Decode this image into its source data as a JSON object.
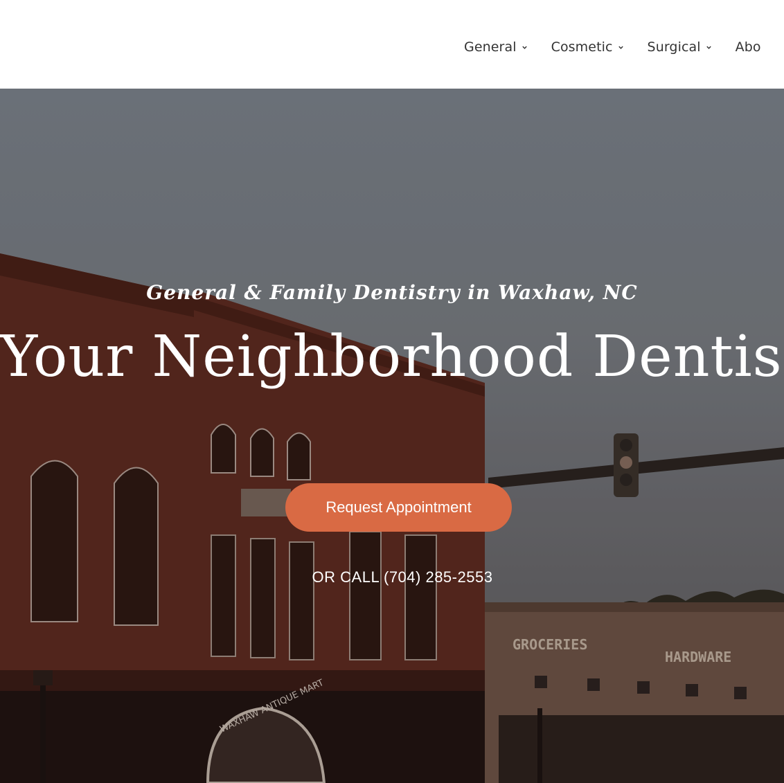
{
  "nav": {
    "items": [
      {
        "label": "General",
        "icon": "chevron-down-icon"
      },
      {
        "label": "Cosmetic",
        "icon": "chevron-down-icon"
      },
      {
        "label": "Surgical",
        "icon": "chevron-down-icon"
      },
      {
        "label": "Abo"
      }
    ]
  },
  "hero": {
    "tagline": "General & Family Dentistry in Waxhaw, NC",
    "headline": "Your Neighborhood Dentist",
    "cta_label": "Request Appointment",
    "call_text": "OR CALL (704) 285-2553",
    "building_signs": [
      "GROCERIES",
      "HARDWARE",
      "WAXHAW ANTIQUE MART"
    ]
  },
  "colors": {
    "accent": "#d96a44",
    "nav_text": "#333333",
    "hero_text": "#ffffff"
  }
}
